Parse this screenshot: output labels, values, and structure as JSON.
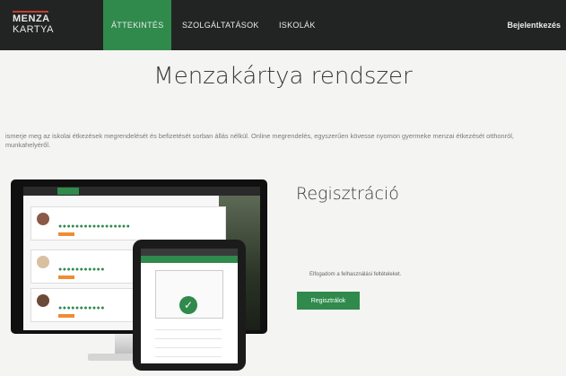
{
  "logo": {
    "line1": "MENZA",
    "line2": "KARTYA"
  },
  "nav": {
    "items": [
      {
        "label": "ÁTTEKINTÉS"
      },
      {
        "label": "SZOLGÁLTATÁSOK"
      },
      {
        "label": "ISKOLÁK"
      }
    ],
    "login": "Bejelentkezés"
  },
  "main": {
    "title": "Menzakártya rendszer",
    "intro": "ismerje meg az iskolai étkezések megrendelését és befizetését sorban állás nélkül. Online megrendelés, egyszerűen kövesse nyomon gyermeke menzai étkezését otthonról, munkahelyéről."
  },
  "register": {
    "title": "Regisztráció",
    "text": "Elfogadom a felhasználási feltételeket.",
    "button": "Regisztrálok"
  },
  "colors": {
    "nav_bg": "#222323",
    "accent": "#2f8a4c",
    "logo_bar": "#c43b32"
  }
}
